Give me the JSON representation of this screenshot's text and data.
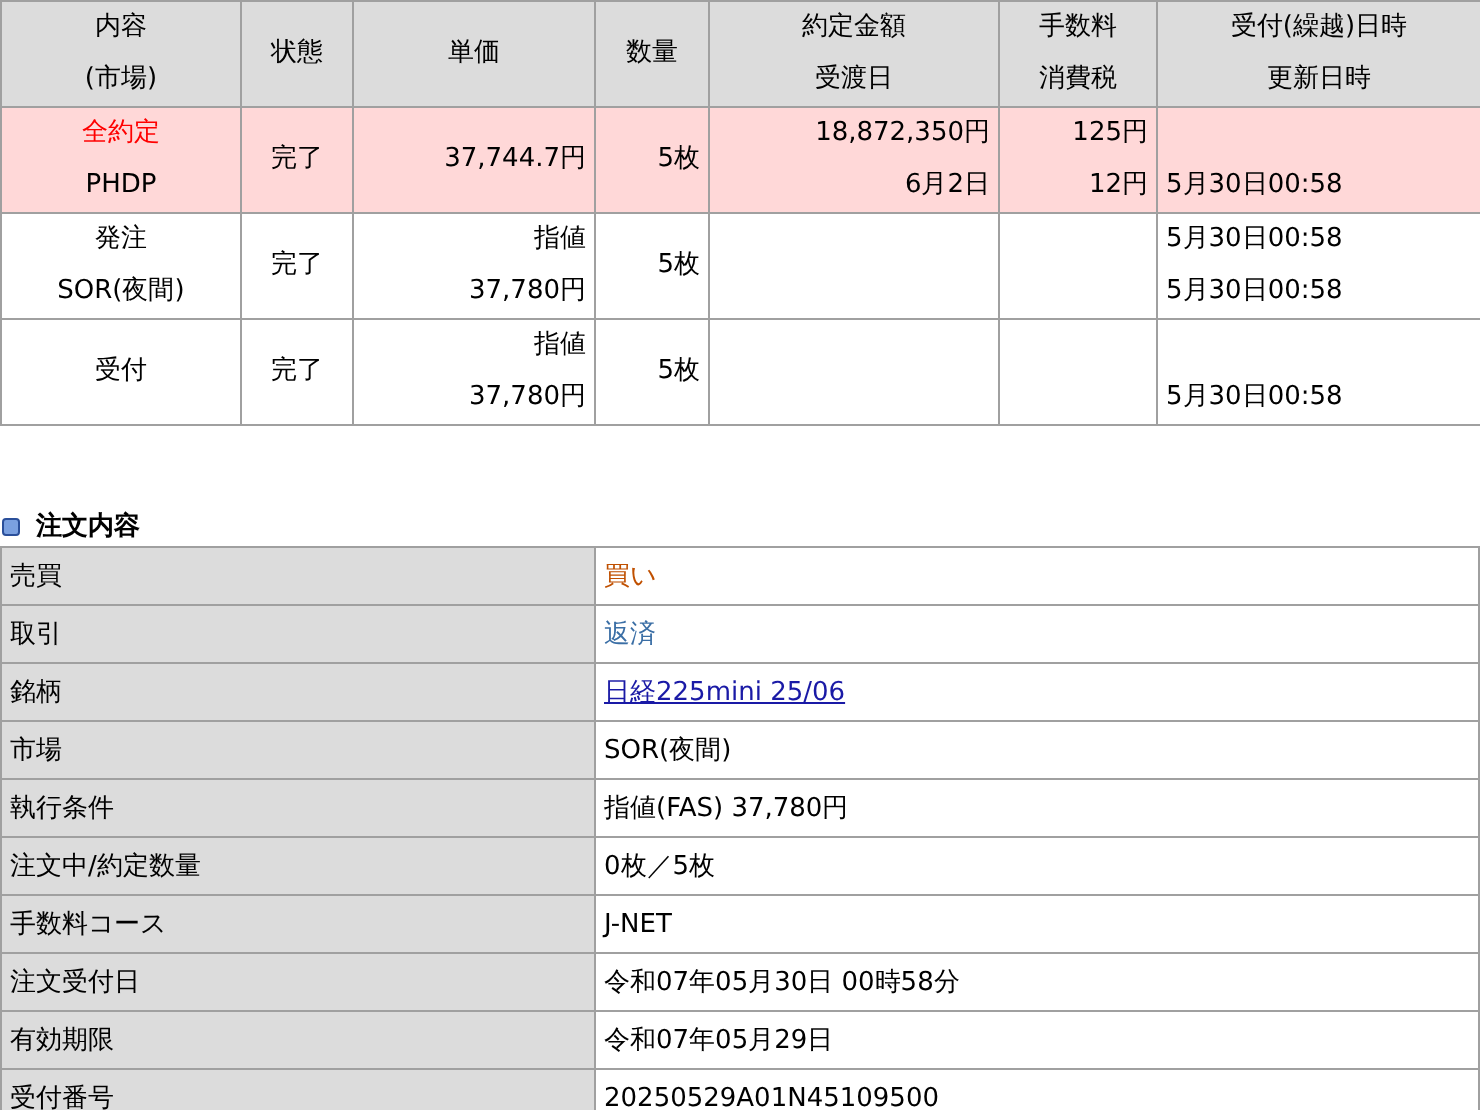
{
  "order_table": {
    "columns": [
      [
        "内容",
        "(市場)"
      ],
      [
        "状態"
      ],
      [
        "単価"
      ],
      [
        "数量"
      ],
      [
        "約定金額",
        "受渡日"
      ],
      [
        "手数料",
        "消費税"
      ],
      [
        "受付(繰越)日時",
        "更新日時"
      ]
    ],
    "rows": [
      {
        "highlighted": true,
        "content": [
          "全約定",
          "PHDP"
        ],
        "status": "完了",
        "price": [
          "37,744.7円"
        ],
        "quantity": "5枚",
        "amount": [
          "18,872,350円",
          "6月2日"
        ],
        "fee": [
          "125円",
          "12円"
        ],
        "updated_at": "5月30日00:58"
      },
      {
        "highlighted": false,
        "content": [
          "発注",
          "SOR(夜間)"
        ],
        "status": "完了",
        "price": [
          "指値",
          "37,780円"
        ],
        "quantity": "5枚",
        "received_at": "5月30日00:58",
        "updated_at": "5月30日00:58"
      },
      {
        "highlighted": false,
        "content": [
          "受付"
        ],
        "status": "完了",
        "price": [
          "指値",
          "37,780円"
        ],
        "quantity": "5枚",
        "updated_at": "5月30日00:58"
      }
    ]
  },
  "order_details": {
    "title": "注文内容",
    "rows": [
      {
        "label": "売買",
        "value": "買い",
        "kind": "buy"
      },
      {
        "label": "取引",
        "value": "返済",
        "kind": "trade"
      },
      {
        "label": "銘柄",
        "value": "日経225mini 25/06",
        "kind": "link"
      },
      {
        "label": "市場",
        "value": "SOR(夜間)",
        "kind": "text"
      },
      {
        "label": "執行条件",
        "value": "指値(FAS) 37,780円",
        "kind": "text"
      },
      {
        "label": "注文中/約定数量",
        "value": "0枚／5枚",
        "kind": "text"
      },
      {
        "label": "手数料コース",
        "value": "J-NET",
        "kind": "text"
      },
      {
        "label": "注文受付日",
        "value": "令和07年05月30日 00時58分",
        "kind": "text"
      },
      {
        "label": "有効期限",
        "value": "令和07年05月29日",
        "kind": "text"
      },
      {
        "label": "受付番号",
        "value": "20250529A01N45109500",
        "kind": "text"
      }
    ]
  }
}
